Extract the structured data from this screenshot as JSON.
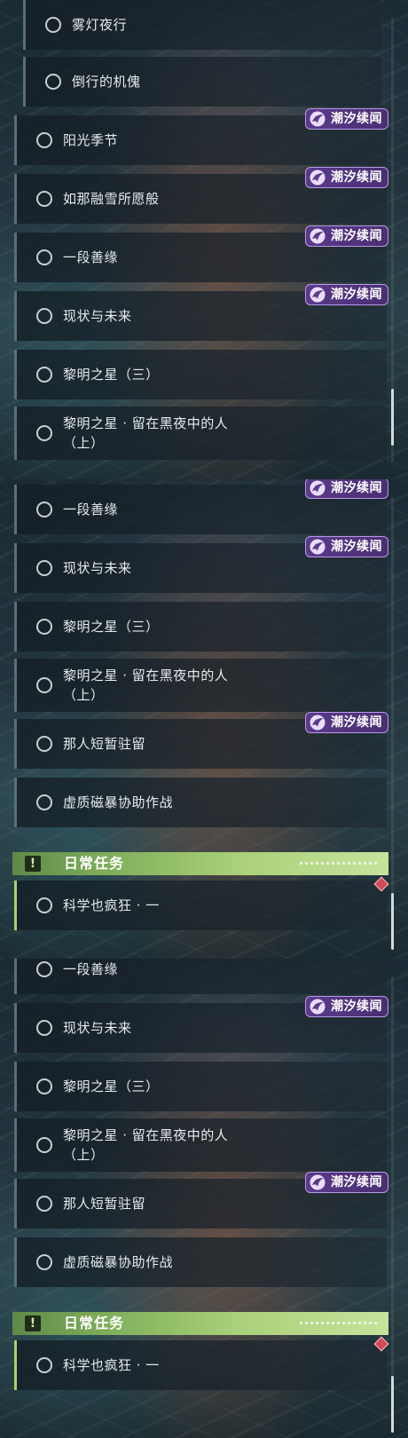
{
  "tag_label": "潮汐续闻",
  "colors": {
    "tag_bg": "#5a3a8a",
    "daily_accent": "#a6d36b",
    "marker": "#d24a5b"
  },
  "panel1": {
    "quests": [
      {
        "name": "雾灯夜行"
      },
      {
        "name": "倒行的机傀"
      },
      {
        "name": "阳光季节"
      },
      {
        "name": "如那融雪所愿般"
      },
      {
        "name": "一段善缘"
      },
      {
        "name": "现状与未来"
      },
      {
        "name": "黎明之星（三）"
      },
      {
        "name": "黎明之星 · 留在黑夜中的人\n（上）"
      }
    ]
  },
  "panel2": {
    "quests": [
      {
        "name": "一段善缘"
      },
      {
        "name": "现状与未来"
      },
      {
        "name": "黎明之星（三）"
      },
      {
        "name": "黎明之星 · 留在黑夜中的人\n（上）"
      },
      {
        "name": "那人短暂驻留"
      },
      {
        "name": "虚质磁暴协助作战"
      }
    ],
    "daily_title": "日常任务",
    "daily_quests": [
      {
        "name": "科学也疯狂 · 一"
      }
    ]
  },
  "panel3": {
    "quests": [
      {
        "name": "一段善缘"
      },
      {
        "name": "现状与未来"
      },
      {
        "name": "黎明之星（三）"
      },
      {
        "name": "黎明之星 · 留在黑夜中的人\n（上）"
      },
      {
        "name": "那人短暂驻留"
      },
      {
        "name": "虚质磁暴协助作战"
      }
    ],
    "daily_title": "日常任务",
    "daily_quests": [
      {
        "name": "科学也疯狂 · 一"
      }
    ]
  }
}
